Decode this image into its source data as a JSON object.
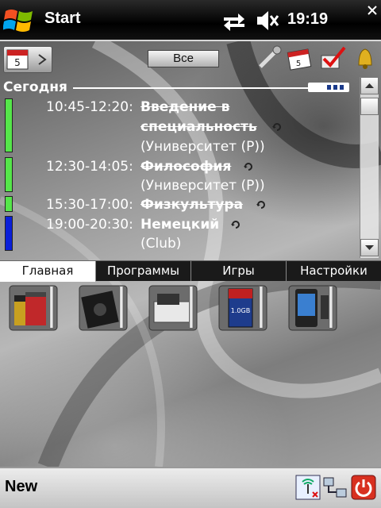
{
  "titlebar": {
    "title": "Start",
    "time": "19:19"
  },
  "toolbar": {
    "filter_label": "Все"
  },
  "today": {
    "label": "Сегодня",
    "appointments": [
      {
        "time": "10:45-12:20:",
        "title_line1": "Введение в",
        "title_line2": "специальность",
        "location": "(Университет (Р))",
        "color": "#55e64a"
      },
      {
        "time": "12:30-14:05:",
        "title_line1": "Философия",
        "location": "(Университет (Р))",
        "color": "#55e64a"
      },
      {
        "time": "15:30-17:00:",
        "title_line1": "Физкультура",
        "color": "#55e64a"
      },
      {
        "time": "19:00-20:30:",
        "title_line1": "Немецкий",
        "location": "(Club)",
        "color": "#0a1fd8"
      }
    ]
  },
  "tabs": [
    {
      "label": "Главная",
      "active": true
    },
    {
      "label": "Программы"
    },
    {
      "label": "Игры"
    },
    {
      "label": "Настройки"
    }
  ],
  "apps": [
    {
      "icon": "battery-icon"
    },
    {
      "icon": "memory-chip-icon"
    },
    {
      "icon": "media-drive-icon"
    },
    {
      "icon": "sd-card-icon",
      "label": "1.0GB"
    },
    {
      "icon": "device-phone-icon"
    }
  ],
  "bottombar": {
    "left_softkey": "New"
  }
}
